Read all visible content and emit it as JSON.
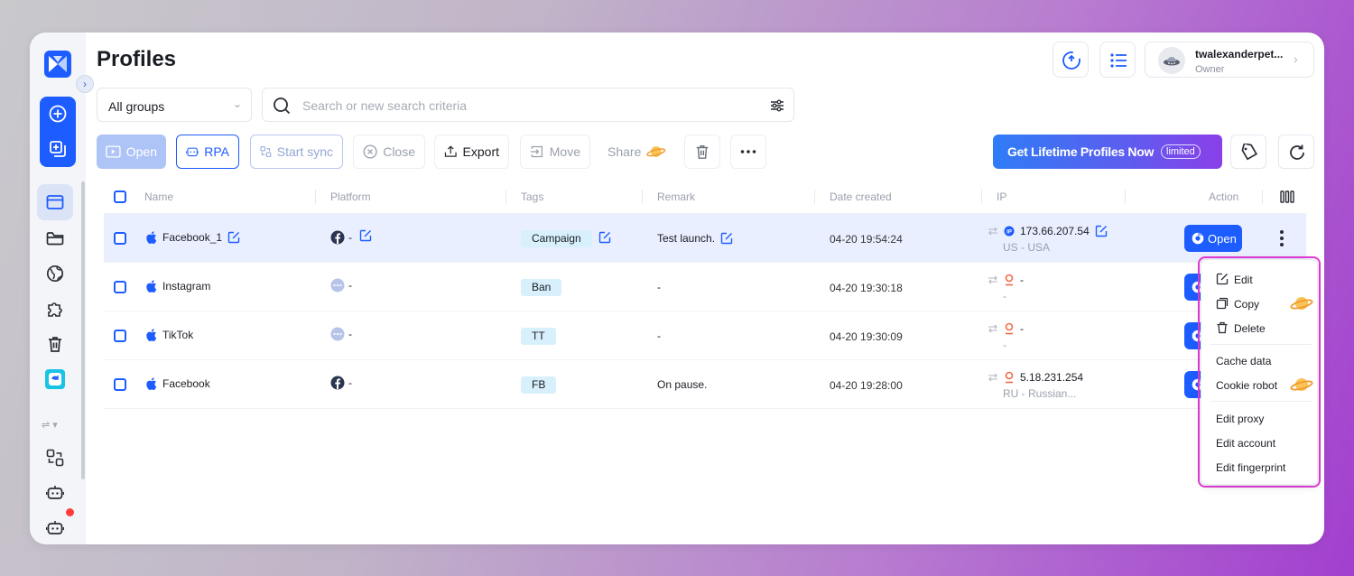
{
  "header": {
    "title": "Profiles"
  },
  "user": {
    "name": "twalexanderpet...",
    "role": "Owner"
  },
  "filters": {
    "group_selected": "All groups",
    "search_placeholder": "Search or new search criteria"
  },
  "toolbar": {
    "open": "Open",
    "rpa": "RPA",
    "start_sync": "Start sync",
    "close": "Close",
    "export": "Export",
    "move": "Move",
    "share": "Share",
    "promo_text": "Get Lifetime Profiles Now",
    "promo_badge": "limited"
  },
  "table": {
    "columns": {
      "name": "Name",
      "platform": "Platform",
      "tags": "Tags",
      "remark": "Remark",
      "date_created": "Date created",
      "ip": "IP",
      "action": "Action"
    },
    "open_label": "Open",
    "rows": [
      {
        "name": "Facebook_1",
        "platform_icon": "facebook-icon",
        "platform": "-",
        "tag": "Campaign",
        "remark": "Test launch.",
        "date": "04-20 19:54:24",
        "ip": "173.66.207.54",
        "location": "US - USA",
        "selected": true
      },
      {
        "name": "Instagram",
        "platform_icon": "more-circle-icon",
        "platform": "-",
        "tag": "Ban",
        "remark": "-",
        "date": "04-20 19:30:18",
        "ip": "-",
        "location": "-",
        "selected": false
      },
      {
        "name": "TikTok",
        "platform_icon": "more-circle-icon",
        "platform": "-",
        "tag": "TT",
        "remark": "-",
        "date": "04-20 19:30:09",
        "ip": "-",
        "location": "-",
        "selected": false
      },
      {
        "name": "Facebook",
        "platform_icon": "facebook-icon",
        "platform": "-",
        "tag": "FB",
        "remark": "On pause.",
        "date": "04-20 19:28:00",
        "ip": "5.18.231.254",
        "location": "RU - Russian...",
        "selected": false
      }
    ]
  },
  "context_menu": {
    "edit": "Edit",
    "copy": "Copy",
    "delete": "Delete",
    "cache_data": "Cache data",
    "cookie_robot": "Cookie robot",
    "edit_proxy": "Edit proxy",
    "edit_account": "Edit account",
    "edit_fingerprint": "Edit fingerprint"
  },
  "colors": {
    "accent": "#1d5cff",
    "highlight": "#e43cd7",
    "tag_bg": "#d8f0fb",
    "selected_row": "#e9efff"
  }
}
